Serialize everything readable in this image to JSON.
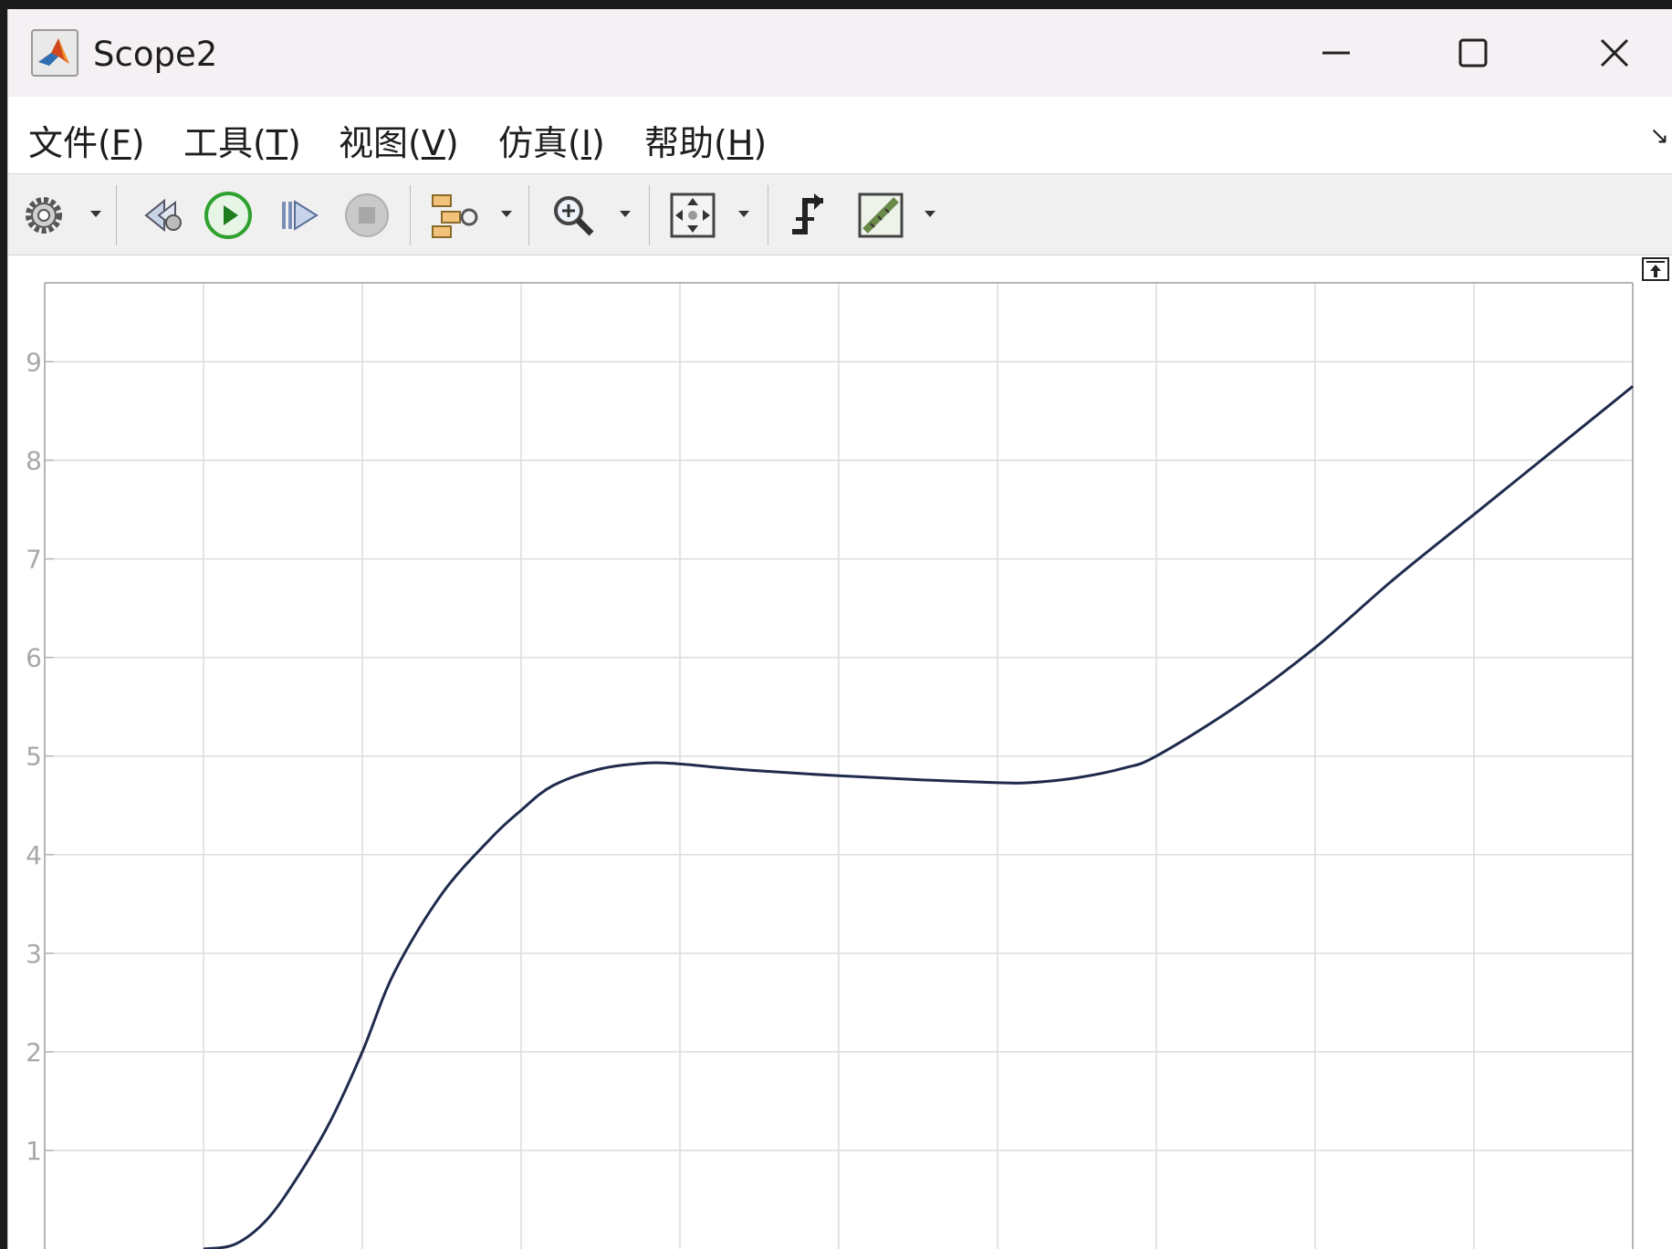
{
  "window": {
    "title": "Scope2",
    "minimize_label": "minimize",
    "maximize_label": "maximize",
    "close_label": "close"
  },
  "menu": {
    "items": [
      {
        "text": "文件(",
        "key": "F",
        "tail": ")"
      },
      {
        "text": "工具(",
        "key": "T",
        "tail": ")"
      },
      {
        "text": "视图(",
        "key": "V",
        "tail": ")"
      },
      {
        "text": "仿真(",
        "key": "I",
        "tail": ")"
      },
      {
        "text": "帮助(",
        "key": "H",
        "tail": ")"
      }
    ],
    "expand_glyph": "↘"
  },
  "toolbar": {
    "icons": [
      "settings-icon",
      "step-back-icon",
      "run-icon",
      "step-forward-icon",
      "stop-icon",
      "signal-select-icon",
      "zoom-in-icon",
      "fit-view-icon",
      "trigger-icon",
      "measure-icon"
    ]
  },
  "colors": {
    "titlebar_bg": "#f4f0f3",
    "toolbar_bg": "#f0f0f0",
    "grid": "#dcdcdc",
    "axis_frame": "#b5b5b5",
    "tick_label": "#a8a8a8",
    "series": "#1f2a4d",
    "run_green": "#2fa12f"
  },
  "chart_data": {
    "type": "line",
    "title": "",
    "xlabel": "",
    "ylabel": "",
    "x_tick_labels": [],
    "y_tick_labels": [
      "1",
      "2",
      "3",
      "4",
      "5",
      "6",
      "7",
      "8",
      "9"
    ],
    "xlim": [
      0,
      10
    ],
    "ylim": [
      0,
      9.8
    ],
    "grid": true,
    "legend": "none",
    "series": [
      {
        "x": [
          1.0,
          1.2,
          1.4,
          1.6,
          1.8,
          2.0,
          2.2,
          2.5,
          2.8,
          3.0,
          3.2,
          3.5,
          3.8,
          4.0,
          4.2,
          4.5,
          5.0,
          5.5,
          6.0,
          6.2,
          6.5,
          6.8,
          7.0,
          7.5,
          8.0,
          8.5,
          9.0,
          9.5,
          10.0
        ],
        "y": [
          0.0,
          0.05,
          0.3,
          0.75,
          1.3,
          2.0,
          2.8,
          3.6,
          4.15,
          4.45,
          4.7,
          4.87,
          4.93,
          4.92,
          4.89,
          4.85,
          4.8,
          4.76,
          4.73,
          4.73,
          4.78,
          4.88,
          5.0,
          5.5,
          6.1,
          6.8,
          7.45,
          8.1,
          8.75
        ]
      }
    ]
  }
}
